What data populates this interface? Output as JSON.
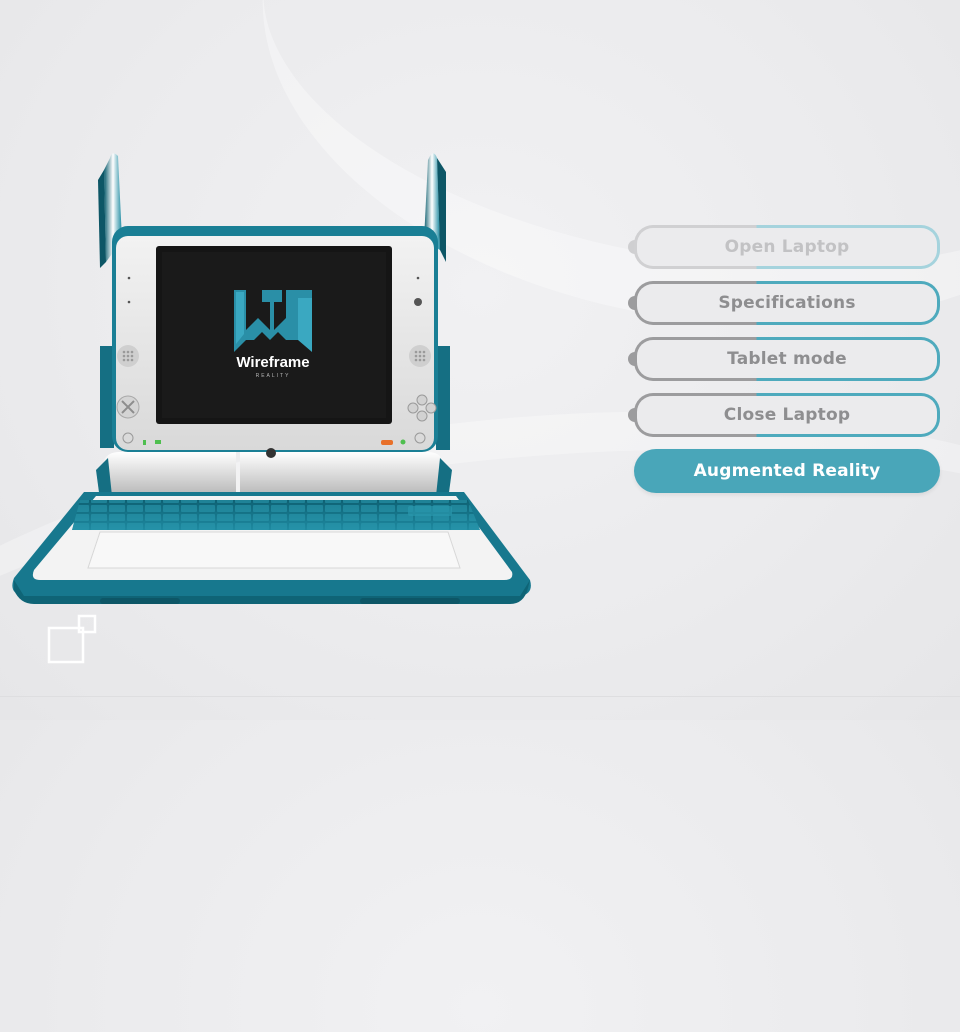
{
  "brand": {
    "name": "Wireframe",
    "sub": "REALITY"
  },
  "menu": {
    "items": [
      {
        "label": "Open Laptop",
        "state": "disabled"
      },
      {
        "label": "Specifications",
        "state": "normal"
      },
      {
        "label": "Tablet mode",
        "state": "normal"
      },
      {
        "label": "Close Laptop",
        "state": "normal"
      },
      {
        "label": "Augmented Reality",
        "state": "active"
      }
    ]
  },
  "colors": {
    "accent": "#49a6b9",
    "laptop_teal": "#147e94",
    "laptop_body": "#e8e8e8",
    "menu_gray": "#9c9c9e",
    "background": "#ebebed"
  },
  "icons": {
    "bottom_left": "expand-view-icon"
  }
}
